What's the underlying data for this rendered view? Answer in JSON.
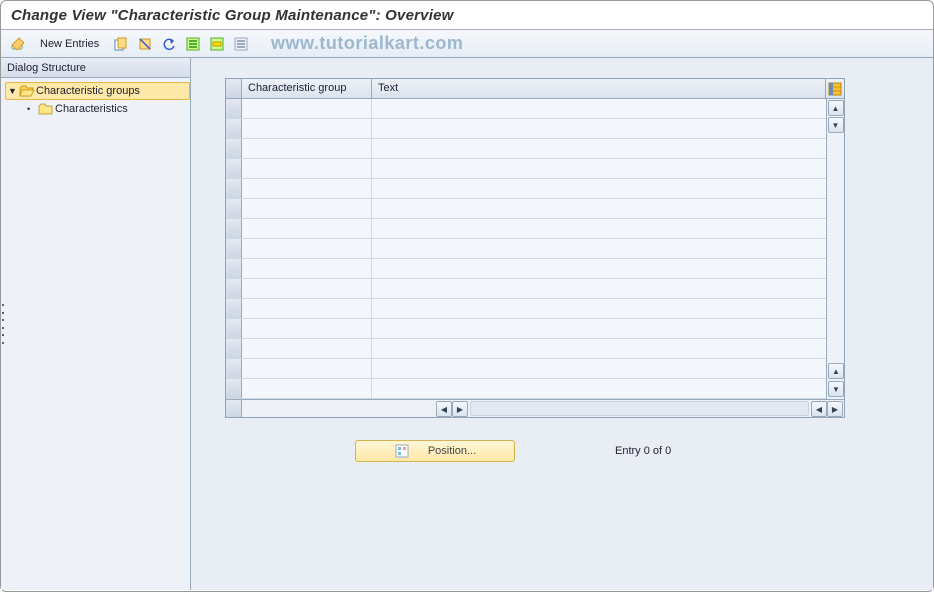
{
  "title": "Change View \"Characteristic Group Maintenance\": Overview",
  "watermark": "www.tutorialkart.com",
  "toolbar": {
    "new_entries": "New Entries"
  },
  "sidebar": {
    "heading": "Dialog Structure",
    "nodes": {
      "root": {
        "label": "Characteristic groups",
        "expanded": true,
        "selected": true
      },
      "child": {
        "label": "Characteristics"
      }
    }
  },
  "grid": {
    "columns": {
      "col1": "Characteristic group",
      "col2": "Text"
    },
    "rows": 15
  },
  "footer": {
    "position_button": "Position...",
    "entry_status": "Entry 0 of 0"
  }
}
